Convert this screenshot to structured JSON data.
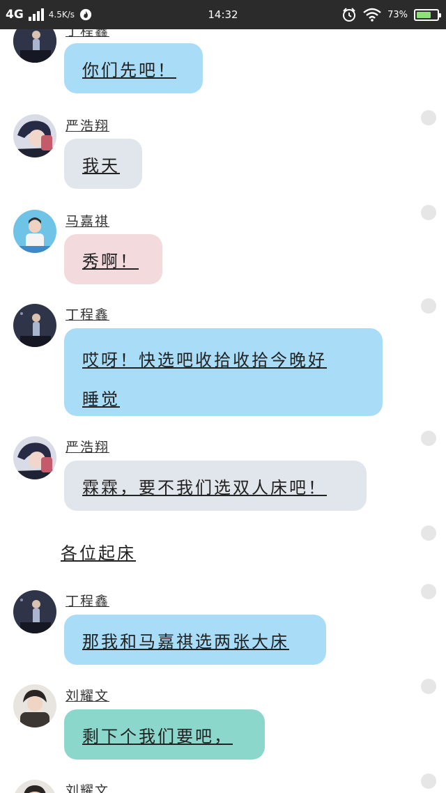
{
  "status_bar": {
    "network": "4G",
    "speed": "4.5K/s",
    "time": "14:32",
    "battery_text": "73%",
    "battery_level": 0.73,
    "icons": [
      "signal-bars-icon",
      "flame-icon",
      "alarm-icon",
      "wifi-icon",
      "battery-icon"
    ]
  },
  "colors": {
    "blue_bubble": "#a8dcf7",
    "gray_bubble": "#e1e6ed",
    "pink_bubble": "#f2dadd",
    "teal_bubble": "#8cd7cc",
    "dot": "#e6e6e6"
  },
  "messages": [
    {
      "sender": "丁程鑫",
      "text": "你们先吧！"
    },
    {
      "sender": "严浩翔",
      "text": "我天"
    },
    {
      "sender": "马嘉祺",
      "text": "秀啊！"
    },
    {
      "sender": "丁程鑫",
      "text_line1": "哎呀！快选吧收拾收拾今晚好",
      "text_line2": "睡觉"
    },
    {
      "sender": "严浩翔",
      "text": "霖霖，要不我们选双人床吧！"
    },
    {
      "narration": "各位起床"
    },
    {
      "sender": "丁程鑫",
      "text": "那我和马嘉祺选两张大床"
    },
    {
      "sender": "刘耀文",
      "text": "剩下个我们要吧，"
    },
    {
      "sender": "刘耀文"
    }
  ]
}
